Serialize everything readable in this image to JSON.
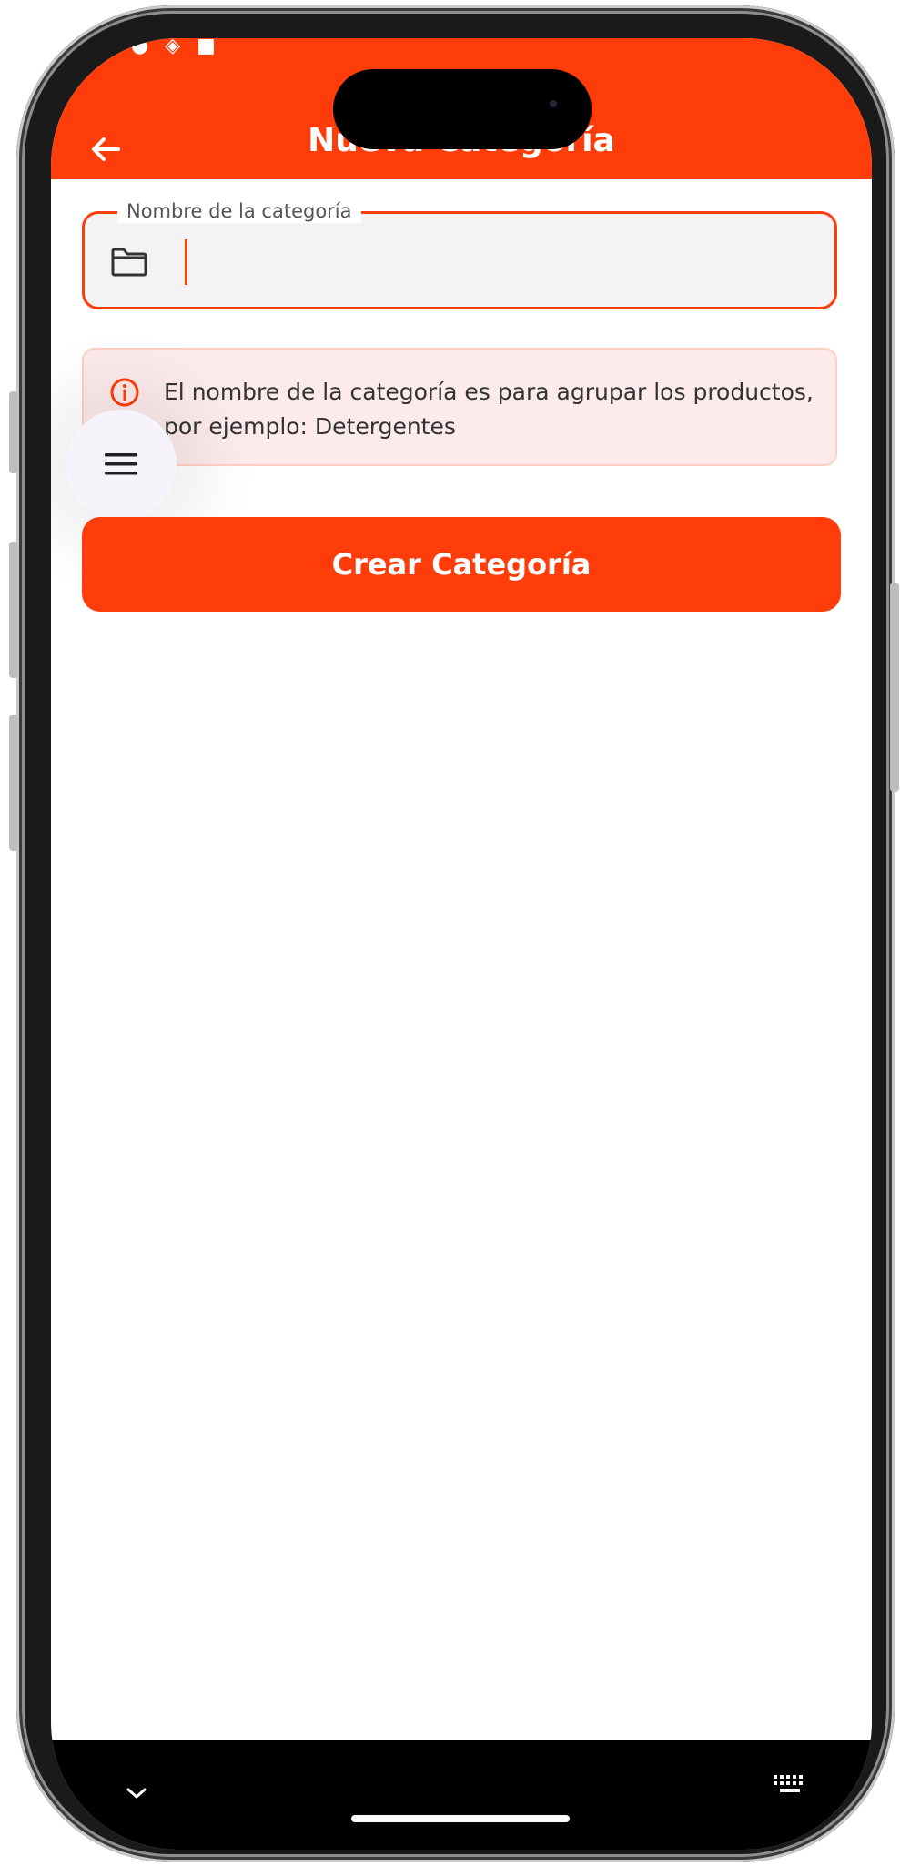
{
  "appbar": {
    "title": "Nueva Categoría"
  },
  "field": {
    "label": "Nombre de la categoría",
    "value": "",
    "placeholder": ""
  },
  "info": {
    "text": "El nombre de la categoría es para agrupar los productos, por ejemplo: Detergentes"
  },
  "actions": {
    "create_label": "Crear Categoría"
  },
  "colors": {
    "accent": "#ff3d0a",
    "info_bg": "#fdeaea",
    "fab_bg": "#f7f3fa"
  },
  "icons": {
    "back": "arrow-left-icon",
    "folder": "folder-icon",
    "info": "info-icon",
    "menu": "menu-icon",
    "nav_down": "chevron-down-icon",
    "keyboard": "keyboard-icon"
  }
}
